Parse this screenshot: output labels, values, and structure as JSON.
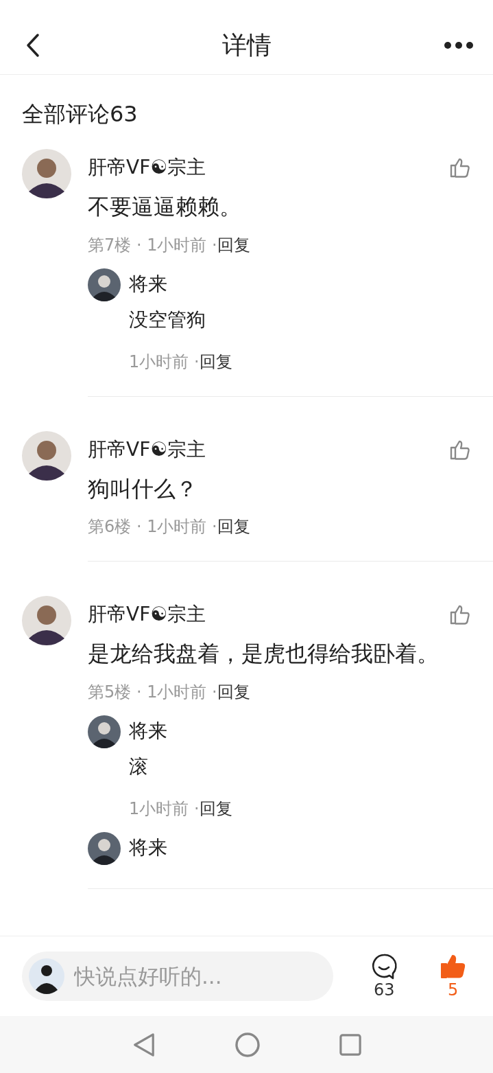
{
  "header": {
    "title": "详情"
  },
  "section_title": "全部评论63",
  "comments": [
    {
      "author": "肝帝VF☯宗主",
      "text": "不要逼逼赖赖。",
      "meta": "第7楼 · 1小时前 ·",
      "reply_label": "回复",
      "liked": false,
      "replies": [
        {
          "author": "将来",
          "text": "没空管狗",
          "meta": "1小时前 ·",
          "reply_label": "回复"
        }
      ]
    },
    {
      "author": "肝帝VF☯宗主",
      "text": "狗叫什么？",
      "meta": "第6楼 · 1小时前 ·",
      "reply_label": "回复",
      "liked": false
    },
    {
      "author": "肝帝VF☯宗主",
      "text": "是龙给我盘着，是虎也得给我卧着。",
      "meta": "第5楼 · 1小时前 ·",
      "reply_label": "回复",
      "liked": false,
      "replies": [
        {
          "author": "将来",
          "text": "滚",
          "meta": "1小时前 ·",
          "reply_label": "回复"
        },
        {
          "author": "将来"
        }
      ]
    }
  ],
  "bottom_bar": {
    "placeholder": "快说点好听的...",
    "comment_count": "63",
    "like_count": "5",
    "liked": true
  }
}
